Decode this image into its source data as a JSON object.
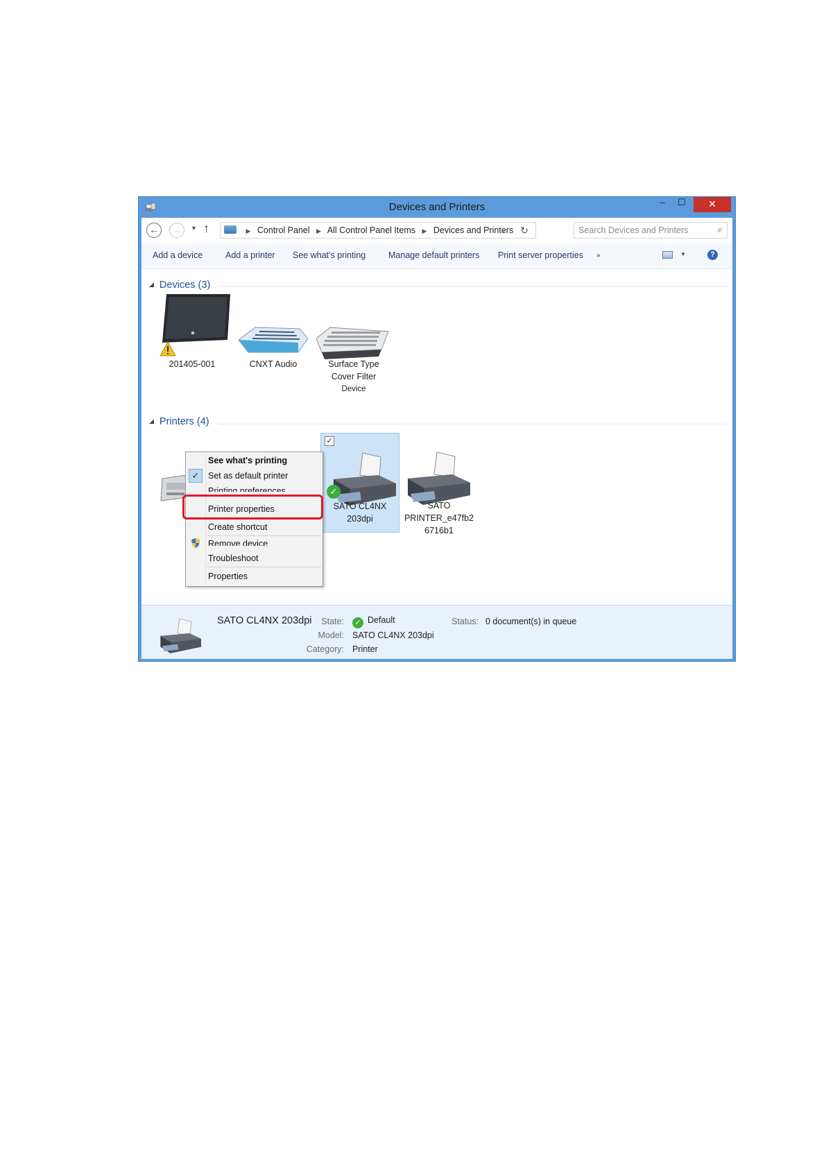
{
  "window": {
    "title": "Devices and Printers",
    "minimize_glyph": "–",
    "maximize_glyph": "☐",
    "close_glyph": "✕"
  },
  "address": {
    "back_glyph": "←",
    "forward_glyph": "→",
    "up_glyph": "↑",
    "breadcrumbs": [
      "Control Panel",
      "All Control Panel Items",
      "Devices and Printers"
    ],
    "search_placeholder": "Search Devices and Printers"
  },
  "toolbar": {
    "commands": [
      "Add a device",
      "Add a printer",
      "See what's printing",
      "Manage default printers",
      "Print server properties"
    ],
    "more_glyph": "»"
  },
  "devices_group": {
    "header": "Devices (3)",
    "items": [
      {
        "name_lines": [
          "201405-001"
        ],
        "icon": "tablet-icon",
        "warning": true
      },
      {
        "name_lines": [
          "CNXT Audio"
        ],
        "icon": "audio-device-icon"
      },
      {
        "name_lines": [
          "Surface Type",
          "Cover Filter",
          "Device"
        ],
        "icon": "keyboard-icon"
      }
    ]
  },
  "printers_group": {
    "header": "Printers (4)",
    "items": [
      {
        "name_lines": [
          "SATO CL4NX",
          "203dpi"
        ],
        "icon": "printer-icon",
        "selected": true,
        "default": true
      },
      {
        "name_lines": [
          "SATO",
          "PRINTER_e47fb2",
          "6716b1"
        ],
        "icon": "printer-icon"
      }
    ]
  },
  "context_menu": {
    "items": [
      {
        "label": "See what's printing",
        "bold": true
      },
      {
        "label": "Set as default printer",
        "checked": true
      },
      {
        "label": "Printing preferences",
        "clipped": true
      },
      {
        "label": "Printer properties",
        "highlighted": true
      },
      {
        "label": "Create shortcut"
      },
      {
        "label": "Remove device",
        "icon": "shield-icon"
      },
      {
        "label": "Troubleshoot"
      },
      {
        "label": "Properties"
      }
    ]
  },
  "details_pane": {
    "name": "SATO CL4NX 203dpi",
    "state_label": "State:",
    "state_value": "Default",
    "model_label": "Model:",
    "model_value": "SATO CL4NX 203dpi",
    "category_label": "Category:",
    "category_value": "Printer",
    "status_label": "Status:",
    "status_value": "0 document(s) in queue"
  },
  "colors": {
    "window_frame": "#5b9bdc",
    "close_button": "#c7312b",
    "selection": "#cde3f7",
    "highlight_box": "#e3162a",
    "group_header": "#1f4f96"
  }
}
